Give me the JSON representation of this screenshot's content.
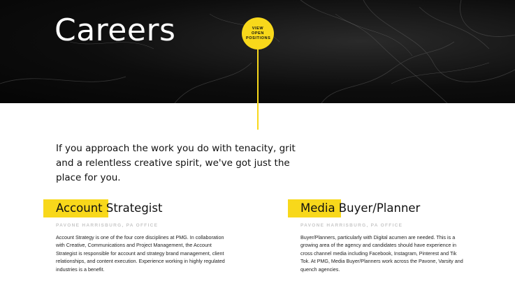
{
  "hero": {
    "title": "Careers",
    "cta_label": "VIEW OPEN POSITIONS"
  },
  "intro": {
    "text": "If you approach the work you do with tenacity, grit and a relentless creative spirit, we've got just the place for you."
  },
  "jobs": [
    {
      "title": "Account Strategist",
      "office": "PAVONE HARRISBURG, PA OFFICE",
      "description": "Account Strategy is one of the four core disciplines at PMG. In collaboration with Creative, Communications and Project Management, the Account Strategist is responsible for account and strategy brand management, client relationships, and content execution. Experience working in highly regulated industries is a benefit."
    },
    {
      "title": "Media Buyer/Planner",
      "office": "PAVONE HARRISBURG, PA OFFICE",
      "description": "Buyer/Planners, particularly with Digital acumen are needed. This is a growing area of the agency and candidates should have experience in cross channel media including Facebook, Instagram, Pinterest and Tik Tok. At PMG, Media Buyer/Planners work across the Pavone, Varsity and quench agencies."
    }
  ],
  "colors": {
    "accent": "#f8d81b",
    "hero_bg": "#0d0d0d"
  }
}
